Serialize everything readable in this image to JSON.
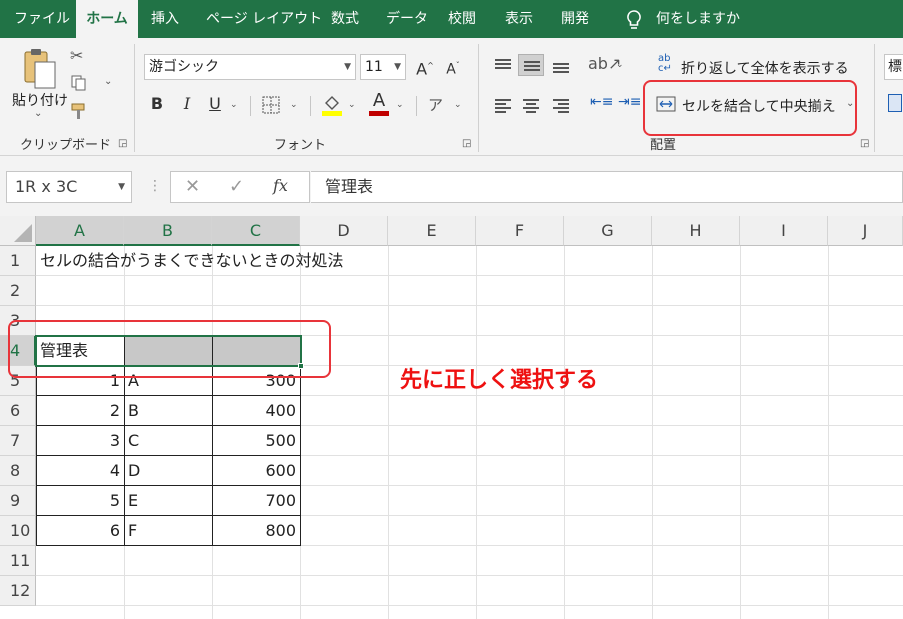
{
  "menu": {
    "tabs": [
      "ファイル",
      "ホーム",
      "挿入",
      "ページ レイアウト",
      "数式",
      "データ",
      "校閲",
      "表示",
      "開発"
    ],
    "active_tab": "ホーム",
    "tell_me": "何をしますか",
    "accent_color": "#217346"
  },
  "ribbon": {
    "clipboard": {
      "paste_label": "貼り付け",
      "group_label": "クリップボード"
    },
    "font": {
      "font_name": "游ゴシック",
      "font_size": "11",
      "bold": "B",
      "italic": "I",
      "underline": "U",
      "grow": "A",
      "shrink": "A",
      "font_color_letter": "A",
      "group_label": "フォント",
      "font_color": "#c00000",
      "highlight_color": "#ffff00"
    },
    "alignment": {
      "wrap_text": "折り返して全体を表示する",
      "merge_center": "セルを結合して中央揃え",
      "group_label": "配置"
    },
    "number": {
      "format_partial": "標"
    }
  },
  "formula_bar": {
    "name_box": "1R x 3C",
    "fx": "fx",
    "value": "管理表"
  },
  "sheet": {
    "columns": [
      "A",
      "B",
      "C",
      "D",
      "E",
      "F",
      "G",
      "H",
      "I",
      "J"
    ],
    "selected_columns": [
      "A",
      "B",
      "C"
    ],
    "rows": [
      "1",
      "2",
      "3",
      "4",
      "5",
      "6",
      "7",
      "8",
      "9",
      "10",
      "11",
      "12"
    ],
    "selected_row": "4",
    "selection_fill": "#c8c8c8",
    "title_cell": "セルの結合がうまくできないときの対処法",
    "header_cell": "管理表",
    "table": [
      {
        "a": "1",
        "b": "A",
        "c": "300"
      },
      {
        "a": "2",
        "b": "B",
        "c": "400"
      },
      {
        "a": "3",
        "b": "C",
        "c": "500"
      },
      {
        "a": "4",
        "b": "D",
        "c": "600"
      },
      {
        "a": "5",
        "b": "E",
        "c": "700"
      },
      {
        "a": "6",
        "b": "F",
        "c": "800"
      }
    ]
  },
  "annotation": {
    "text": "先に正しく選択する",
    "color": "#e8343a"
  }
}
